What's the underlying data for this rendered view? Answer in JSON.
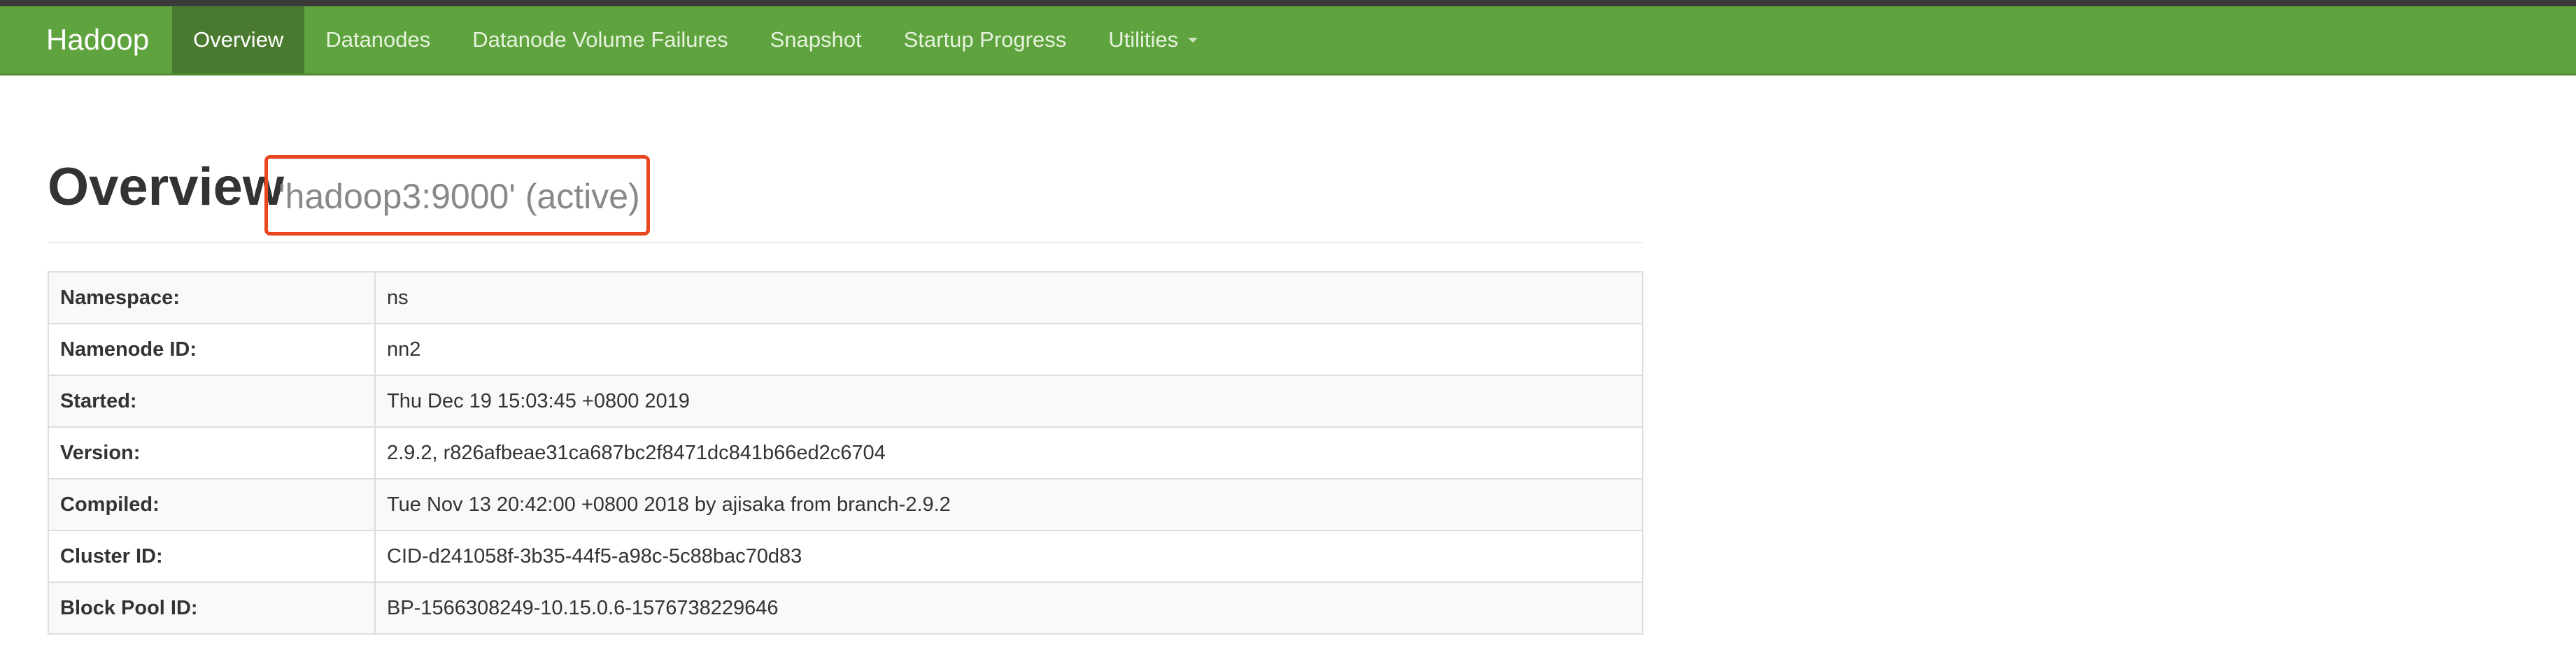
{
  "navbar": {
    "brand": "Hadoop",
    "items": [
      {
        "label": "Overview",
        "active": true
      },
      {
        "label": "Datanodes",
        "active": false
      },
      {
        "label": "Datanode Volume Failures",
        "active": false
      },
      {
        "label": "Snapshot",
        "active": false
      },
      {
        "label": "Startup Progress",
        "active": false
      },
      {
        "label": "Utilities",
        "active": false,
        "dropdown": true
      }
    ],
    "colors": {
      "bar": "#5fa33e",
      "active": "#4a7a2f"
    }
  },
  "header": {
    "title": "Overview",
    "subtitle": "'hadoop3:9000' (active)",
    "highlight_color": "#e8461f"
  },
  "overview_table": {
    "rows": [
      {
        "label": "Namespace:",
        "value": "ns"
      },
      {
        "label": "Namenode ID:",
        "value": "nn2"
      },
      {
        "label": "Started:",
        "value": "Thu Dec 19 15:03:45 +0800 2019"
      },
      {
        "label": "Version:",
        "value": "2.9.2, r826afbeae31ca687bc2f8471dc841b66ed2c6704"
      },
      {
        "label": "Compiled:",
        "value": "Tue Nov 13 20:42:00 +0800 2018 by ajisaka from branch-2.9.2"
      },
      {
        "label": "Cluster ID:",
        "value": "CID-d241058f-3b35-44f5-a98c-5c88bac70d83"
      },
      {
        "label": "Block Pool ID:",
        "value": "BP-1566308249-10.15.0.6-1576738229646"
      }
    ]
  }
}
